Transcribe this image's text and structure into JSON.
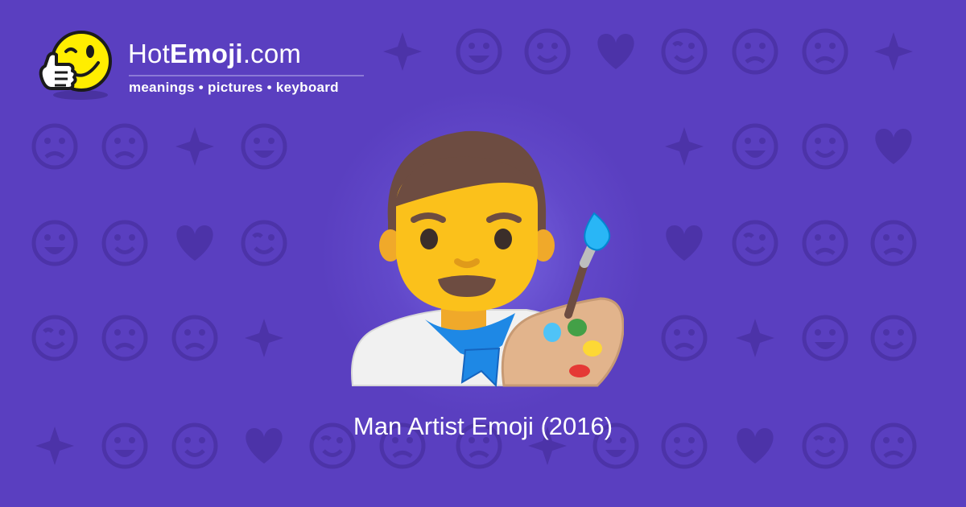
{
  "site": {
    "name_light": "Hot",
    "name_bold": "Emoji",
    "name_suffix": ".com",
    "tagline": "meanings • pictures • keyboard"
  },
  "caption": "Man Artist Emoji (2016)",
  "colors": {
    "background": "#5a3fc0",
    "pattern": "#4c33a8",
    "skin": "#fbc11b",
    "hair": "#6d4c41",
    "scarf": "#1e88e5",
    "palette": "#e2b48c"
  },
  "icons": {
    "logo": "thumbs-up-winking-face-icon",
    "hero": "man-artist-emoji-icon",
    "pattern": "emoji-pattern"
  }
}
